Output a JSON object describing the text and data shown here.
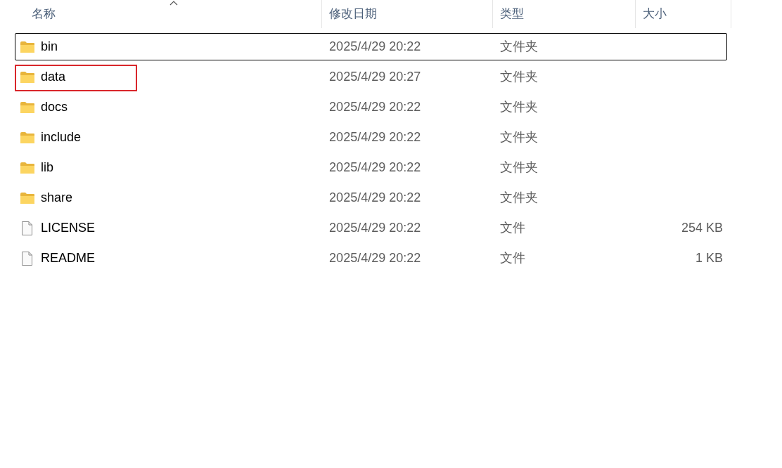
{
  "columns": [
    {
      "label": "名称",
      "sorted": true
    },
    {
      "label": "修改日期",
      "sorted": false
    },
    {
      "label": "类型",
      "sorted": false
    },
    {
      "label": "大小",
      "sorted": false
    }
  ],
  "rows": [
    {
      "kind": "folder",
      "name": "bin",
      "modified": "2025/4/29 20:22",
      "type": "文件夹",
      "focused": true,
      "marked": false
    },
    {
      "kind": "folder",
      "name": "data",
      "modified": "2025/4/29 20:27",
      "type": "文件夹",
      "focused": false,
      "marked": true
    },
    {
      "kind": "folder",
      "name": "docs",
      "modified": "2025/4/29 20:22",
      "type": "文件夹",
      "focused": false,
      "marked": false
    },
    {
      "kind": "folder",
      "name": "include",
      "modified": "2025/4/29 20:22",
      "type": "文件夹",
      "focused": false,
      "marked": false
    },
    {
      "kind": "folder",
      "name": "lib",
      "modified": "2025/4/29 20:22",
      "type": "文件夹",
      "focused": false,
      "marked": false
    },
    {
      "kind": "folder",
      "name": "share",
      "modified": "2025/4/29 20:22",
      "type": "文件夹",
      "focused": false,
      "marked": false
    },
    {
      "kind": "file",
      "name": "LICENSE",
      "modified": "2025/4/29 20:22",
      "type": "文件",
      "size": "254 KB",
      "focused": false,
      "marked": false
    },
    {
      "kind": "file",
      "name": "README",
      "modified": "2025/4/29 20:22",
      "type": "文件",
      "size": "1 KB",
      "focused": false,
      "marked": false
    }
  ]
}
